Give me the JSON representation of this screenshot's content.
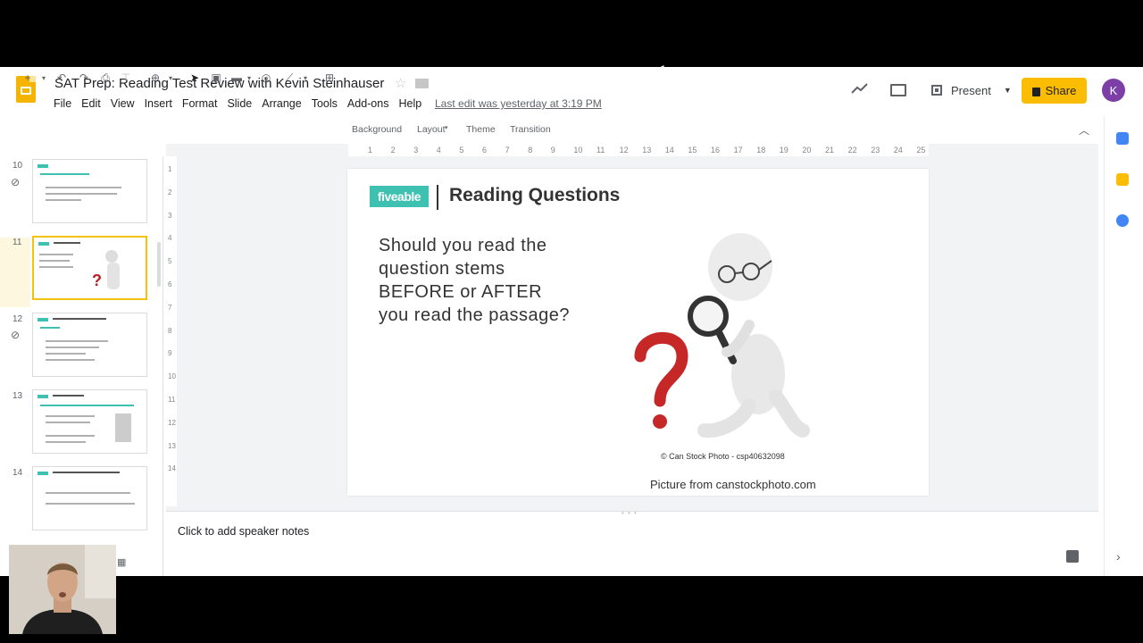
{
  "document": {
    "title": "SAT Prep: Reading Test Review with Kevin Steinhauser",
    "last_edit": "Last edit was yesterday at 3:19 PM"
  },
  "menu": [
    "File",
    "Edit",
    "View",
    "Insert",
    "Format",
    "Slide",
    "Arrange",
    "Tools",
    "Add-ons",
    "Help"
  ],
  "header": {
    "present_label": "Present",
    "share_label": "Share",
    "avatar_initial": "K"
  },
  "toolbar": {
    "background_label": "Background",
    "layout_label": "Layout",
    "theme_label": "Theme",
    "transition_label": "Transition"
  },
  "ruler_ticks": [
    "1",
    "2",
    "3",
    "4",
    "5",
    "6",
    "7",
    "8",
    "9",
    "10",
    "11",
    "12",
    "13",
    "14",
    "15",
    "16",
    "17",
    "18",
    "19",
    "20",
    "21",
    "22",
    "23",
    "24",
    "25"
  ],
  "ruler_v_ticks": [
    "1",
    "2",
    "3",
    "4",
    "5",
    "6",
    "7",
    "8",
    "9",
    "10",
    "11",
    "12",
    "13",
    "14"
  ],
  "filmstrip": {
    "numbers": [
      "10",
      "11",
      "12",
      "13",
      "14"
    ]
  },
  "slide": {
    "logo_text": "fiveable",
    "title": "Reading Questions",
    "question": "Should you read the question stems BEFORE or AFTER you read the passage?",
    "photo_credit": "© Can Stock Photo - csp40632098",
    "picture_from": "Picture from canstockphoto.com"
  },
  "notes": {
    "placeholder": "Click to add speaker notes"
  },
  "colors": {
    "accent": "#3ec1b1",
    "share": "#fbbc04",
    "selected_thumb": "#f4c20d",
    "slides_icon": "#f4b400"
  }
}
